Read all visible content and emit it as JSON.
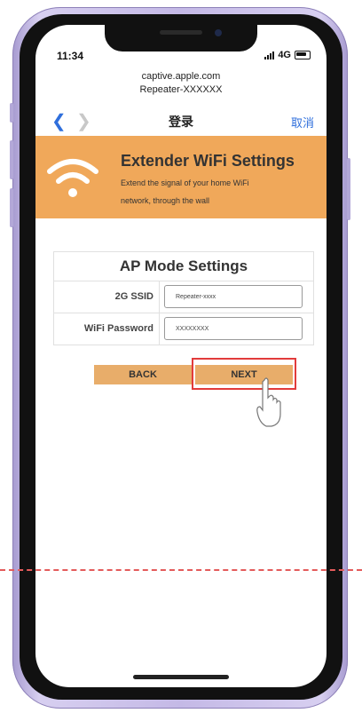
{
  "status": {
    "time": "11:34",
    "network": "4G"
  },
  "browser": {
    "url_line1": "captive.apple.com",
    "url_line2": "Repeater-XXXXXX",
    "title": "登录",
    "cancel": "取消"
  },
  "banner": {
    "title": "Extender WiFi Settings",
    "subtitle_line1": "Extend the signal of your home WiFi",
    "subtitle_line2": "network, through the wall"
  },
  "form": {
    "title": "AP Mode Settings",
    "ssid_label": "2G SSID",
    "ssid_value": "Repeater-xxxx",
    "password_label": "WiFi Password",
    "password_value": "XXXXXXXX"
  },
  "buttons": {
    "back": "BACK",
    "next": "NEXT"
  },
  "colors": {
    "banner": "#f0a85a",
    "button": "#e8ad6a",
    "highlight": "#e23b3b",
    "link": "#2f6fdc"
  }
}
